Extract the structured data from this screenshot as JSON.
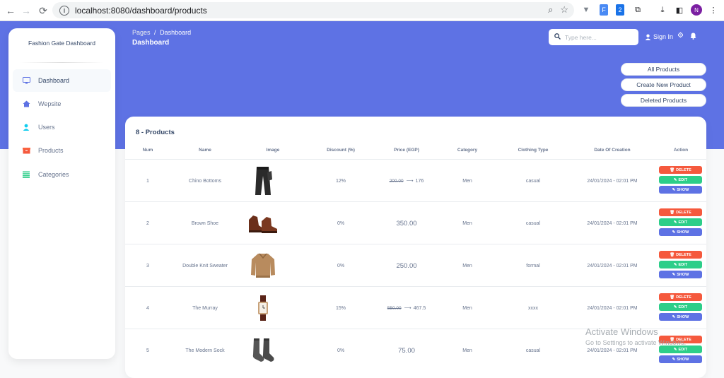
{
  "browser": {
    "url": "localhost:8080/dashboard/products",
    "profile_initial": "N"
  },
  "sidebar": {
    "brand": "Fashion Gate Dashboard",
    "items": [
      {
        "label": "Dashboard",
        "icon": "monitor-icon",
        "active": true
      },
      {
        "label": "Wepsite",
        "icon": "home-icon",
        "active": false
      },
      {
        "label": "Users",
        "icon": "user-icon",
        "active": false
      },
      {
        "label": "Products",
        "icon": "box-icon",
        "active": false
      },
      {
        "label": "Categories",
        "icon": "list-icon",
        "active": false
      }
    ]
  },
  "header": {
    "breadcrumb_root": "Pages",
    "breadcrumb_sep": "/",
    "breadcrumb_current": "Dashboard",
    "title": "Dashboard",
    "search_placeholder": "Type here...",
    "signin": "Sign In"
  },
  "actions": {
    "all_products": "All Products",
    "create_product": "Create New Product",
    "deleted_products": "Deleted Products"
  },
  "table": {
    "title": "8 - Products",
    "headers": [
      "Num",
      "Name",
      "Image",
      "Discount (%)",
      "Price (EGP)",
      "Category",
      "Clothing Type",
      "Date Of Creation",
      "Action"
    ],
    "action_labels": {
      "delete": "DELETE",
      "edit": "EDIT",
      "show": "SHOW"
    },
    "rows": [
      {
        "num": "1",
        "name": "Chino Bottoms",
        "image": "pants",
        "discount": "12%",
        "old_price": "200.00",
        "arrow": "⟶",
        "price": "176",
        "category": "Men",
        "type": "casual",
        "date": "24/01/2024 - 02:01 PM"
      },
      {
        "num": "2",
        "name": "Brown Shoe",
        "image": "shoes",
        "discount": "0%",
        "old_price": "",
        "arrow": "",
        "price": "350.00",
        "category": "Men",
        "type": "casual",
        "date": "24/01/2024 - 02:01 PM"
      },
      {
        "num": "3",
        "name": "Double Knit Sweater",
        "image": "sweater",
        "discount": "0%",
        "old_price": "",
        "arrow": "",
        "price": "250.00",
        "category": "Men",
        "type": "formal",
        "date": "24/01/2024 - 02:01 PM"
      },
      {
        "num": "4",
        "name": "The Murray",
        "image": "watch",
        "discount": "15%",
        "old_price": "550.00",
        "arrow": "⟶",
        "price": "467.5",
        "category": "Men",
        "type": "xxxx",
        "date": "24/01/2024 - 02:01 PM"
      },
      {
        "num": "5",
        "name": "The Modern Sock",
        "image": "socks",
        "discount": "0%",
        "old_price": "",
        "arrow": "",
        "price": "75.00",
        "category": "Men",
        "type": "casual",
        "date": "24/01/2024 - 02:01 PM"
      }
    ]
  },
  "watermark": {
    "title": "Activate Windows",
    "subtitle": "Go to Settings to activate Windows."
  }
}
